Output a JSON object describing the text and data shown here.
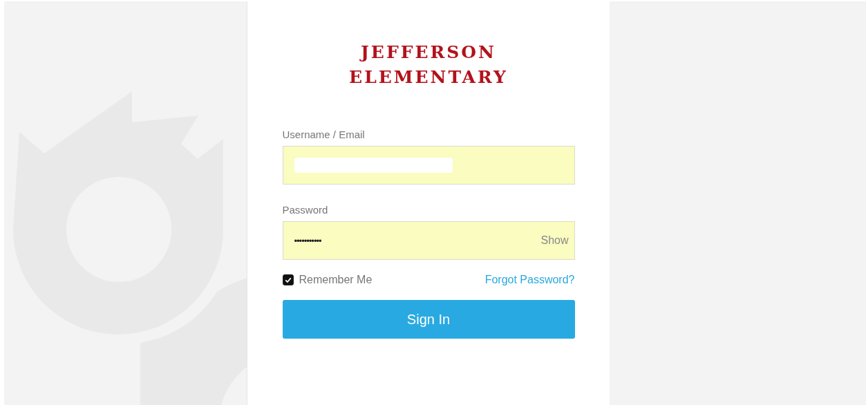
{
  "logo": {
    "lines": [
      "JEFFERSON",
      "ELEMENTARY"
    ]
  },
  "username": {
    "label": "Username / Email",
    "redacted": true
  },
  "password": {
    "label": "Password",
    "value": "•••••••••••",
    "toggle": "Show"
  },
  "remember": {
    "label": "Remember Me",
    "checked": true
  },
  "forgot_link": "Forgot Password?",
  "sign_in_button": "Sign In"
}
